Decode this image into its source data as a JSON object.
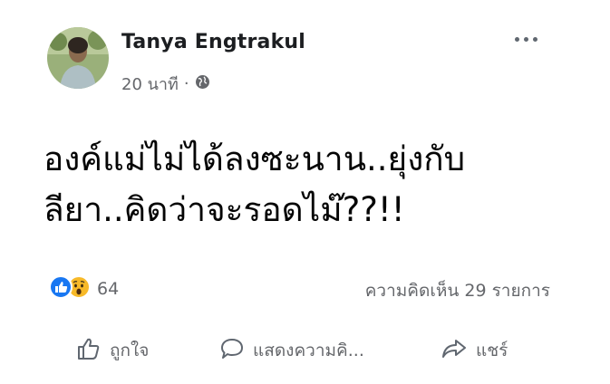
{
  "post": {
    "author": "Tanya Engtrakul",
    "time": "20 นาที",
    "separator": "·",
    "privacy_icon": "globe-icon",
    "more_icon": "more-options-icon",
    "lines": [
      "องค์แม่ไม่ได้ลงซะนาน..ยุ่งกับ",
      "ลียา..คิดว่าจะรอดไม๊??!!"
    ]
  },
  "stats": {
    "reaction_icons": [
      "like-icon",
      "wow-icon"
    ],
    "reaction_count": "64",
    "comments": "ความคิดเห็น 29 รายการ"
  },
  "actions": {
    "like": "ถูกใจ",
    "comment": "แสดงความคิ...",
    "share": "แชร์"
  },
  "colors": {
    "like_blue": "#1877f2",
    "wow_yellow": "#f7b928",
    "muted": "#65676b"
  }
}
